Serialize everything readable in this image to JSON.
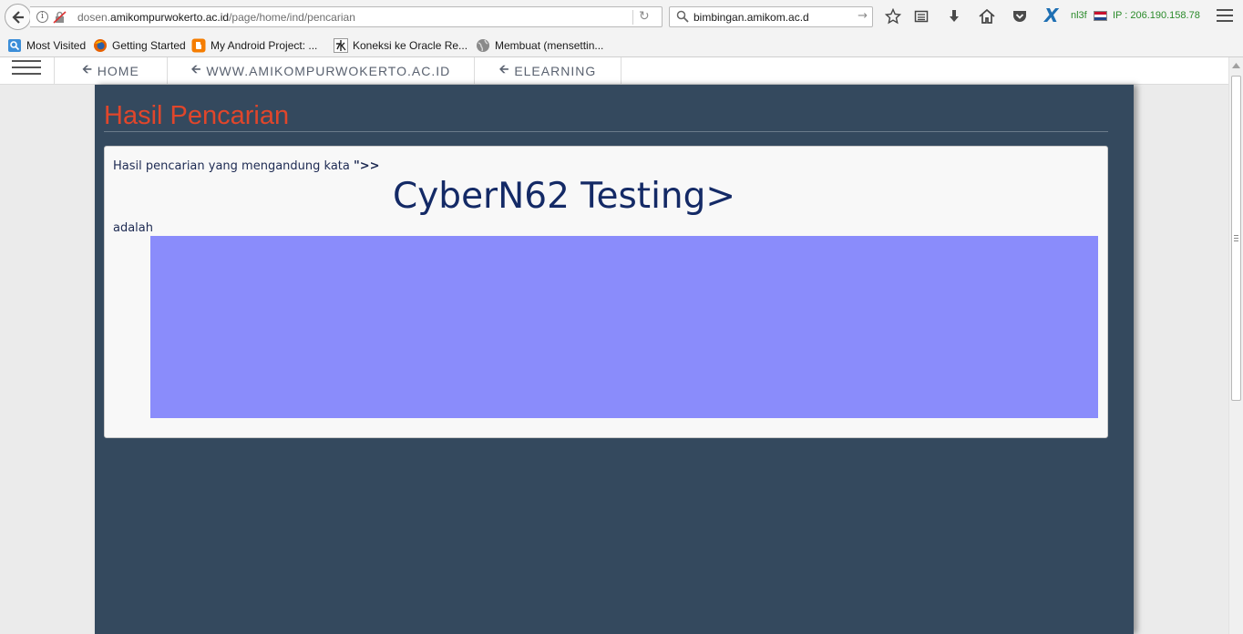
{
  "browser": {
    "url_prefix": "dosen.",
    "url_domain": "amikompurwokerto.ac.id",
    "url_path": "/page/home/ind/pencarian",
    "search_value": "bimbingan.amikom.ac.d",
    "addon_label": "nl3f",
    "ip_label": "IP : 206.190.158.78",
    "icons": [
      "back-arrow-icon",
      "info-icon",
      "insecure-lock-icon",
      "reload-icon",
      "search-icon",
      "go-arrow-icon",
      "star-icon",
      "reading-list-icon",
      "download-icon",
      "home-icon",
      "pocket-icon",
      "x-addon-icon",
      "flag-icon",
      "menu-icon"
    ]
  },
  "bookmarks": [
    {
      "label": "Most Visited",
      "icon": "most-visited-icon"
    },
    {
      "label": "Getting Started",
      "icon": "firefox-icon"
    },
    {
      "label": "My Android Project: ...",
      "icon": "blogger-icon"
    },
    {
      "label": "Koneksi ke Oracle Re...",
      "icon": "kanji-icon"
    },
    {
      "label": "Membuat (mensettin...",
      "icon": "globe-icon"
    }
  ],
  "site_nav": {
    "items": [
      {
        "label": "HOME"
      },
      {
        "label": "WWW.AMIKOMPURWOKERTO.AC.ID"
      },
      {
        "label": "ELEARNING"
      }
    ]
  },
  "main": {
    "title": "Hasil Pencarian",
    "intro_text": "Hasil pencarian yang mengandung kata ",
    "intro_mark": "\">>",
    "query": "CyberN62 Testing>",
    "suffix": "adalah",
    "colors": {
      "title": "#e0462b",
      "panel": "#34495e",
      "result_area": "#8a8cfb"
    }
  }
}
